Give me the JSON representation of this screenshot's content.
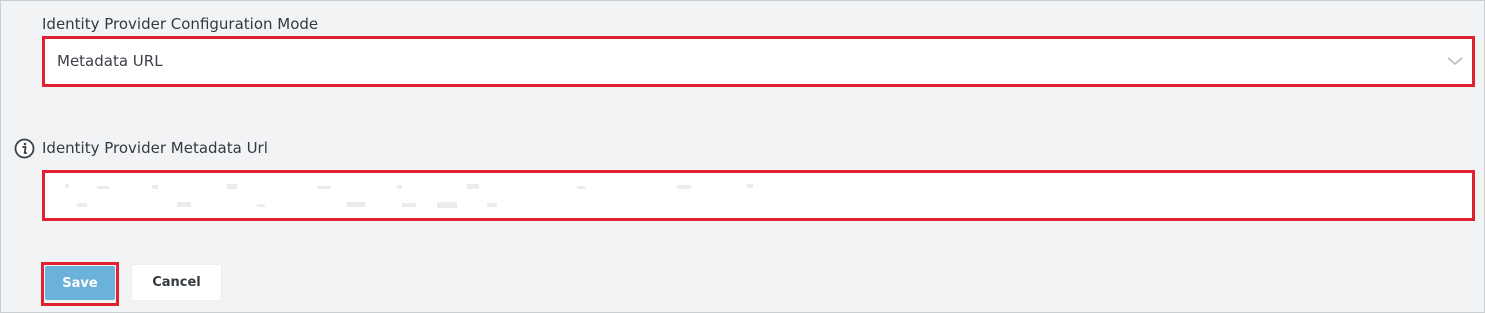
{
  "config_mode": {
    "label": "Identity Provider Configuration Mode",
    "selected_value": "Metadata URL"
  },
  "metadata_url": {
    "label": "Identity Provider Metadata Url",
    "value": ""
  },
  "buttons": {
    "save_label": "Save",
    "cancel_label": "Cancel"
  },
  "colors": {
    "highlight": "#e0212f",
    "save_button": "#6ab2d9",
    "background": "#f2f3f5"
  },
  "icons": {
    "info": "info-icon",
    "dropdown": "chevron-down-icon"
  }
}
